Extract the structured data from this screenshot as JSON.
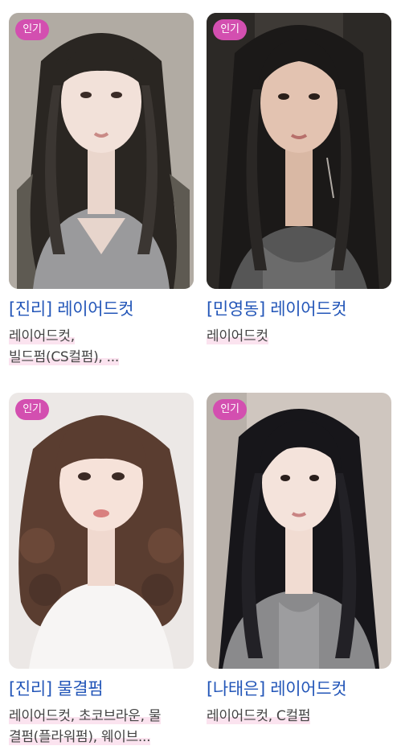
{
  "items": [
    {
      "badge": "인기",
      "title": "[진리] 레이어드컷",
      "desc_line1": "레이어드컷,",
      "desc_line2": "빌드펌(CS컬펌), ..."
    },
    {
      "badge": "인기",
      "title": "[민영동] 레이어드컷",
      "desc_line1": "레이어드컷",
      "desc_line2": ""
    },
    {
      "badge": "인기",
      "title": "[진리] 물결펌",
      "desc_line1": "레이어드컷, 초코브라운, 물",
      "desc_line2": "결펌(플라워펌), 웨이브..."
    },
    {
      "badge": "인기",
      "title": "[나태은] 레이어드컷",
      "desc_line1": "레이어드컷, C컬펌",
      "desc_line2": ""
    }
  ],
  "colors": {
    "badge": "#d34fb0",
    "title": "#2356b8",
    "highlight": "#fbe3ef"
  }
}
